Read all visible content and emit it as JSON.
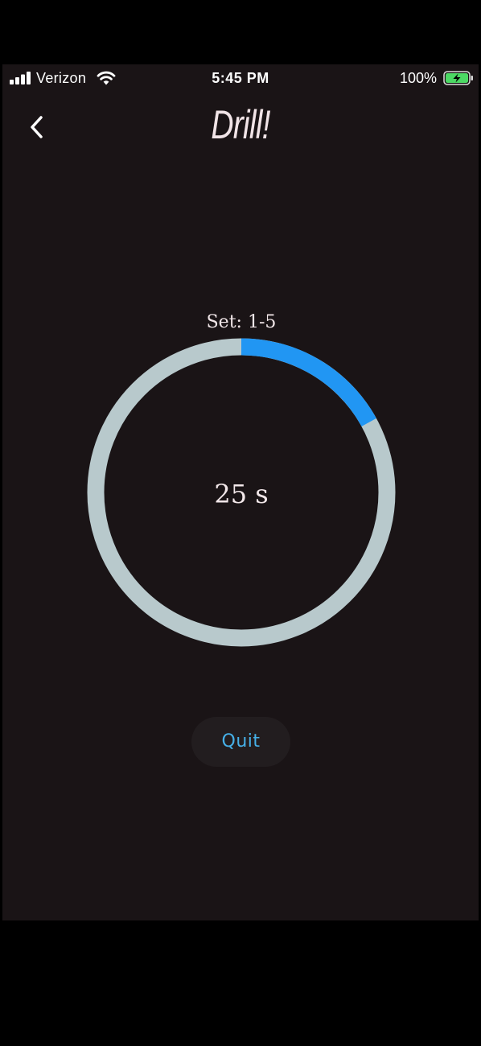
{
  "status_bar": {
    "carrier": "Verizon",
    "time": "5:45 PM",
    "battery_percent": "100%",
    "signal_icon": "signal-bars-icon",
    "wifi_icon": "wifi-icon",
    "battery_icon": "battery-charging-icon"
  },
  "header": {
    "back_icon": "chevron-left-icon",
    "title": "Drill!"
  },
  "timer": {
    "set_label": "Set: 1-5",
    "time_text": "25 s",
    "progress_fraction": 0.17,
    "track_color": "#b8c9cc",
    "progress_color": "#2196f3"
  },
  "actions": {
    "quit_label": "Quit"
  },
  "colors": {
    "background": "#1a1416",
    "accent_text": "#46b0e8"
  }
}
